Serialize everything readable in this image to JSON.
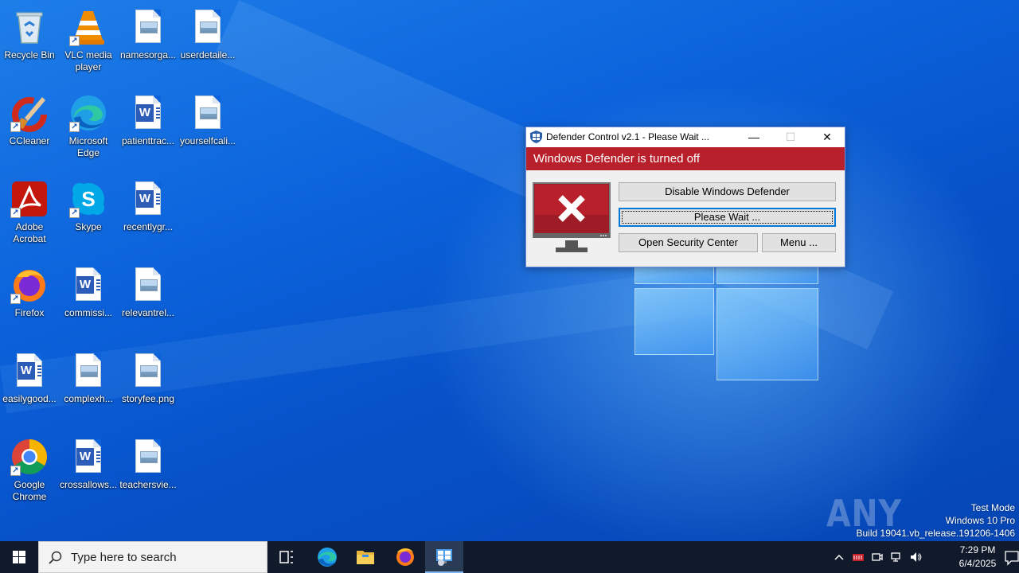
{
  "desktop": {
    "icons": [
      {
        "label": "Recycle Bin",
        "icon": "recycle-bin-icon"
      },
      {
        "label": "VLC media player",
        "icon": "vlc-icon"
      },
      {
        "label": "namesorga...",
        "icon": "image-file-icon"
      },
      {
        "label": "userdetaile...",
        "icon": "image-file-icon"
      },
      {
        "label": "CCleaner",
        "icon": "ccleaner-icon"
      },
      {
        "label": "Microsoft Edge",
        "icon": "edge-icon"
      },
      {
        "label": "patienttrac...",
        "icon": "word-doc-icon"
      },
      {
        "label": "yourselfcali...",
        "icon": "image-file-icon"
      },
      {
        "label": "Adobe Acrobat",
        "icon": "acrobat-icon"
      },
      {
        "label": "Skype",
        "icon": "skype-icon"
      },
      {
        "label": "recentlygr...",
        "icon": "word-doc-icon"
      },
      {
        "label": "Firefox",
        "icon": "firefox-icon"
      },
      {
        "label": "commissi...",
        "icon": "word-doc-icon"
      },
      {
        "label": "relevantrel...",
        "icon": "image-file-icon"
      },
      {
        "label": "easilygood...",
        "icon": "word-doc-icon"
      },
      {
        "label": "complexh...",
        "icon": "image-file-icon"
      },
      {
        "label": "storyfee.png",
        "icon": "image-file-icon"
      },
      {
        "label": "Google Chrome",
        "icon": "chrome-icon"
      },
      {
        "label": "crossallows...",
        "icon": "word-doc-icon"
      },
      {
        "label": "teachersvie...",
        "icon": "image-file-icon"
      }
    ]
  },
  "dialog": {
    "title": "Defender Control v2.1 - Please Wait ...",
    "minimize": "—",
    "maximize": "☐",
    "close": "✕",
    "banner": "Windows Defender is turned off",
    "buttons": {
      "disable": "Disable Windows Defender",
      "wait": "Please Wait ...",
      "security": "Open Security Center",
      "menu": "Menu ..."
    },
    "colors": {
      "banner": "#b8202b",
      "monitor_red": "#b8202b"
    }
  },
  "watermark": {
    "text": "ANY RUN"
  },
  "system_info": {
    "line1": "Test Mode",
    "line2": "Windows 10 Pro",
    "line3": "Build 19041.vb_release.191206-1406"
  },
  "taskbar": {
    "search_placeholder": "Type here to search",
    "items": [
      "task-view-icon",
      "edge-icon",
      "file-explorer-icon",
      "firefox-icon",
      "defender-control-icon"
    ],
    "clock": {
      "time": "7:29 PM",
      "date": "6/4/2025"
    }
  }
}
